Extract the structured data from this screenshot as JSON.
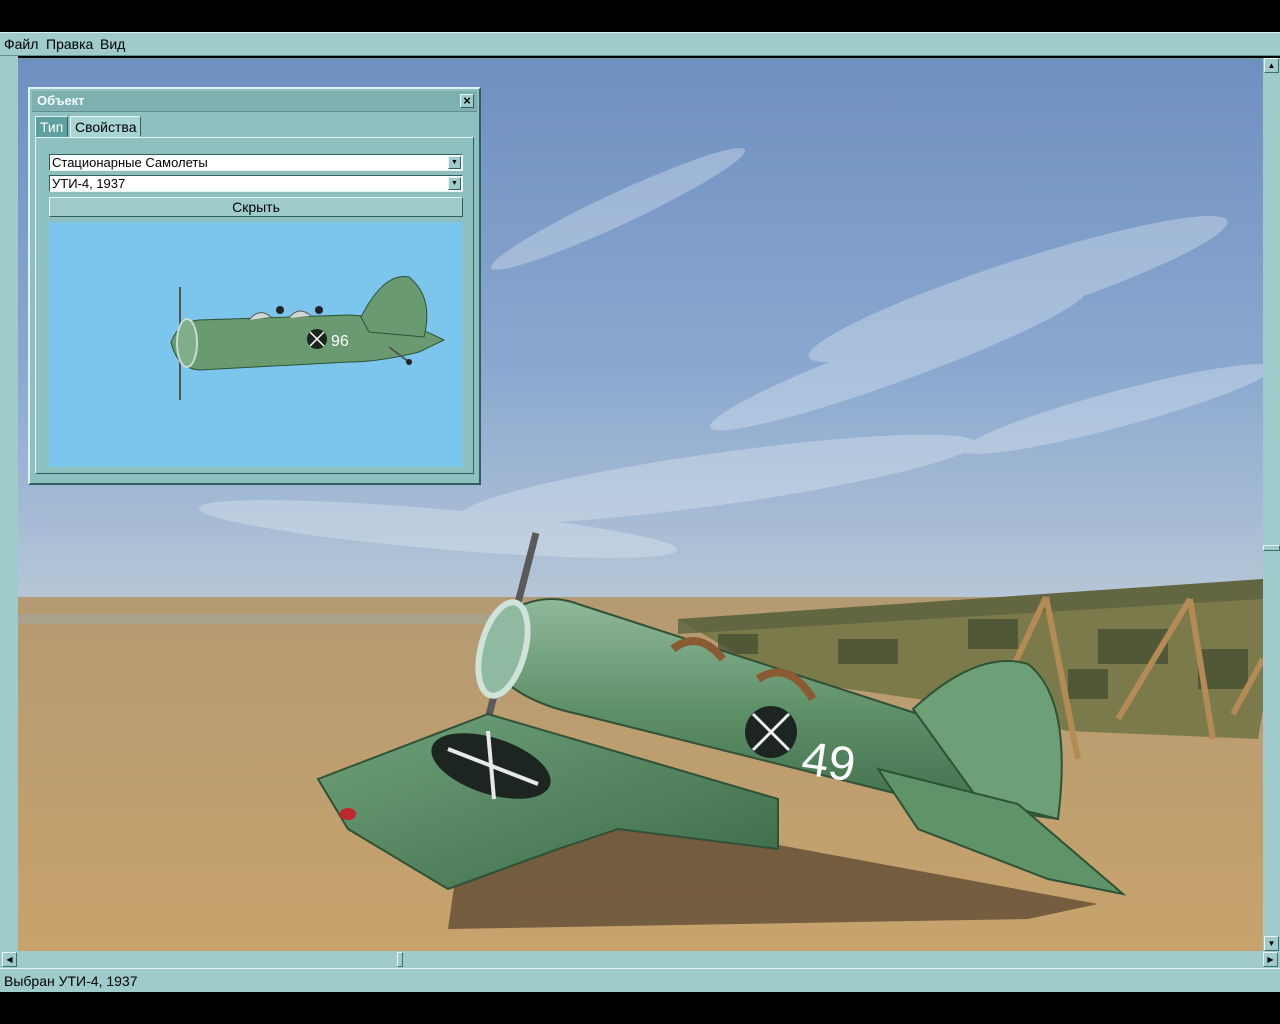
{
  "menu": [
    "Файл",
    "Правка",
    "Вид"
  ],
  "dialog": {
    "title": "Объект",
    "close_icon": "close-icon",
    "tabs": [
      {
        "label": "Тип",
        "active": true
      },
      {
        "label": "Свойства",
        "active": false
      }
    ],
    "category_select": "Стационарные Самолеты",
    "object_select": "УТИ-4, 1937",
    "hide_button": "Скрыть",
    "preview_tail_number": "96"
  },
  "scene": {
    "aircraft_number": "49",
    "sky_color": "#7a98c4",
    "ground_color": "#c2a070",
    "aircraft_color": "#5e9468"
  },
  "status": {
    "text": "Выбран УТИ-4, 1937"
  }
}
